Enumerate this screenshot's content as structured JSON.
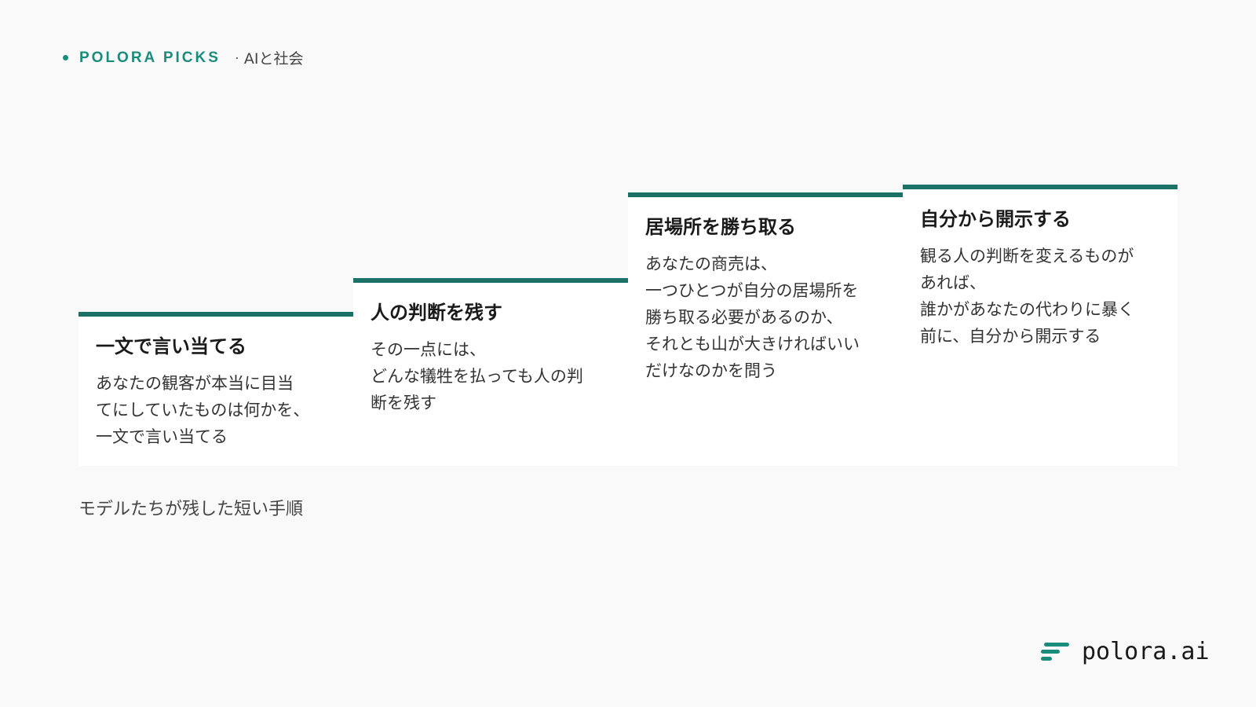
{
  "header": {
    "brand": "POLORA PICKS",
    "separator": "·",
    "topic": "AIと社会"
  },
  "steps": [
    {
      "title": "一文で言い当てる",
      "body": "あなたの観客が本当に目当\nてにしていたものは何かを、\n一文で言い当てる"
    },
    {
      "title": "人の判断を残す",
      "body": "その一点には、\nどんな犠牲を払っても人の判\n断を残す"
    },
    {
      "title": "居場所を勝ち取る",
      "body": "あなたの商売は、\n一つひとつが自分の居場所を\n勝ち取る必要があるのか、\nそれとも山が大きければいい\nだけなのかを問う"
    },
    {
      "title": "自分から開示する",
      "body": "観る人の判断を変えるものが\nあれば、\n誰かがあなたの代わりに暴く\n前に、自分から開示する"
    }
  ],
  "caption": "モデルたちが残した短い手順",
  "logo": {
    "text": "polora.ai",
    "icon": "polora-logo-icon"
  },
  "colors": {
    "accent": "#1a8c7c",
    "bar": "#1b7166",
    "background": "#f9f9f9"
  }
}
